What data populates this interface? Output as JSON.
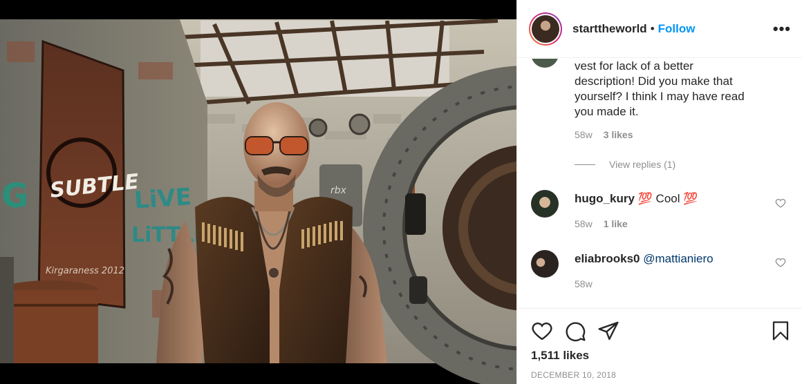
{
  "post": {
    "image_alt": "Bald man with mirrored sunglasses and a leather fringe vest standing in an abandoned graffiti-covered industrial building"
  },
  "header": {
    "username": "starttheworld",
    "separator": "•",
    "follow_label": "Follow",
    "more_icon": "more-options-icon"
  },
  "comments": [
    {
      "text": "vest for lack of a better description! Did you make that yourself? I think I may have read you made it.",
      "age": "58w",
      "likes": "3 likes",
      "view_replies": "View replies (1)"
    },
    {
      "username": "hugo_kury",
      "emoji_1": "💯",
      "body": "Cool",
      "emoji_2": "💯",
      "age": "58w",
      "likes": "1 like"
    },
    {
      "username": "eliabrooks0",
      "mention": "@mattianiero",
      "age": "58w"
    }
  ],
  "actions": {
    "like_icon": "heart-icon",
    "comment_icon": "comment-icon",
    "share_icon": "share-icon",
    "save_icon": "bookmark-icon"
  },
  "likes_count": "1,511 likes",
  "date": "DECEMBER 10, 2018",
  "colors": {
    "link": "#0095f6",
    "muted": "#8e8e8e",
    "text": "#262626",
    "divider": "#efefef"
  }
}
